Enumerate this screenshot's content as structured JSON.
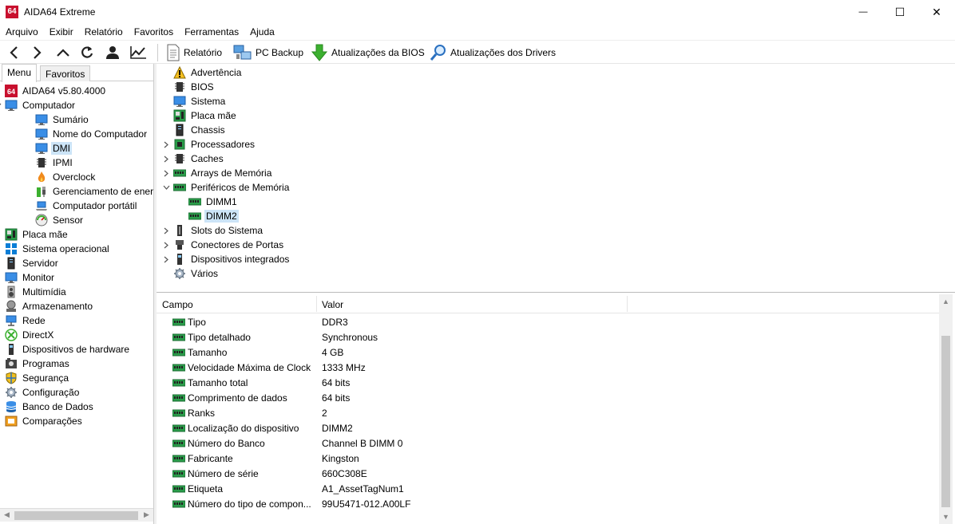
{
  "window": {
    "app_icon_text": "64",
    "title": "AIDA64 Extreme",
    "minimize": "—",
    "maximize": "☐",
    "close": "✕"
  },
  "menu": [
    "Arquivo",
    "Exibir",
    "Relatório",
    "Favoritos",
    "Ferramentas",
    "Ajuda"
  ],
  "toolbar": {
    "report": "Relatório",
    "pc_backup": "PC Backup",
    "bios_updates": "Atualizações da BIOS",
    "driver_updates": "Atualizações dos Drivers"
  },
  "tabs": {
    "menu": "Menu",
    "favorites": "Favoritos"
  },
  "left_tree": [
    {
      "label": "AIDA64 v5.80.4000",
      "icon": "aida64-icon",
      "level": 0,
      "chevron": ""
    },
    {
      "label": "Computador",
      "icon": "monitor-icon",
      "level": 0,
      "chevron": "open"
    },
    {
      "label": "Sumário",
      "icon": "monitor-icon",
      "level": 2,
      "chevron": ""
    },
    {
      "label": "Nome do Computador",
      "icon": "monitor-icon",
      "level": 2,
      "chevron": ""
    },
    {
      "label": "DMI",
      "icon": "monitor-icon",
      "level": 2,
      "chevron": "",
      "selected": true
    },
    {
      "label": "IPMI",
      "icon": "chip-icon",
      "level": 2,
      "chevron": ""
    },
    {
      "label": "Overclock",
      "icon": "flame-icon",
      "level": 2,
      "chevron": ""
    },
    {
      "label": "Gerenciamento de ener",
      "icon": "power-plug-icon",
      "level": 2,
      "chevron": ""
    },
    {
      "label": "Computador portátil",
      "icon": "laptop-icon",
      "level": 2,
      "chevron": ""
    },
    {
      "label": "Sensor",
      "icon": "gauge-icon",
      "level": 2,
      "chevron": ""
    },
    {
      "label": "Placa mãe",
      "icon": "motherboard-icon",
      "level": 0,
      "chevron": "closed"
    },
    {
      "label": "Sistema operacional",
      "icon": "windows-icon",
      "level": 0,
      "chevron": "closed"
    },
    {
      "label": "Servidor",
      "icon": "server-icon",
      "level": 0,
      "chevron": "closed"
    },
    {
      "label": "Monitor",
      "icon": "monitor-icon",
      "level": 0,
      "chevron": "closed"
    },
    {
      "label": "Multimídia",
      "icon": "speaker-icon",
      "level": 0,
      "chevron": "closed"
    },
    {
      "label": "Armazenamento",
      "icon": "storage-icon",
      "level": 0,
      "chevron": "closed"
    },
    {
      "label": "Rede",
      "icon": "network-icon",
      "level": 0,
      "chevron": "closed"
    },
    {
      "label": "DirectX",
      "icon": "xbox-icon",
      "level": 0,
      "chevron": "closed"
    },
    {
      "label": "Dispositivos de hardware",
      "icon": "device-icon",
      "level": 0,
      "chevron": "closed"
    },
    {
      "label": "Programas",
      "icon": "programs-icon",
      "level": 0,
      "chevron": "closed"
    },
    {
      "label": "Segurança",
      "icon": "shield-icon",
      "level": 0,
      "chevron": "closed"
    },
    {
      "label": "Configuração",
      "icon": "gear-icon",
      "level": 0,
      "chevron": "closed"
    },
    {
      "label": "Banco de Dados",
      "icon": "database-icon",
      "level": 0,
      "chevron": "closed"
    },
    {
      "label": "Comparações",
      "icon": "benchmark-icon",
      "level": 0,
      "chevron": "closed"
    }
  ],
  "dmi_tree": [
    {
      "label": "Advertência",
      "icon": "warning-icon",
      "level": 0,
      "chevron": ""
    },
    {
      "label": "BIOS",
      "icon": "chip-icon",
      "level": 0,
      "chevron": ""
    },
    {
      "label": "Sistema",
      "icon": "monitor-icon",
      "level": 0,
      "chevron": ""
    },
    {
      "label": "Placa mãe",
      "icon": "motherboard-icon",
      "level": 0,
      "chevron": ""
    },
    {
      "label": "Chassis",
      "icon": "server-icon",
      "level": 0,
      "chevron": ""
    },
    {
      "label": "Processadores",
      "icon": "cpu-icon",
      "level": 0,
      "chevron": "closed"
    },
    {
      "label": "Caches",
      "icon": "chip-icon",
      "level": 0,
      "chevron": "closed"
    },
    {
      "label": "Arrays de Memória",
      "icon": "ram-icon",
      "level": 0,
      "chevron": "closed"
    },
    {
      "label": "Periféricos de Memória",
      "icon": "ram-icon",
      "level": 0,
      "chevron": "open"
    },
    {
      "label": "DIMM1",
      "icon": "ram-icon",
      "level": 1,
      "chevron": ""
    },
    {
      "label": "DIMM2",
      "icon": "ram-icon",
      "level": 1,
      "chevron": "",
      "selected": true
    },
    {
      "label": "Slots do Sistema",
      "icon": "slot-icon",
      "level": 0,
      "chevron": "closed"
    },
    {
      "label": "Conectores de Portas",
      "icon": "port-icon",
      "level": 0,
      "chevron": "closed"
    },
    {
      "label": "Dispositivos integrados",
      "icon": "device-icon",
      "level": 0,
      "chevron": "closed"
    },
    {
      "label": "Vários",
      "icon": "gear-icon",
      "level": 0,
      "chevron": ""
    }
  ],
  "details": {
    "col_field": "Campo",
    "col_value": "Valor",
    "rows": [
      {
        "field": "Tipo",
        "value": "DDR3"
      },
      {
        "field": "Tipo detalhado",
        "value": "Synchronous"
      },
      {
        "field": "Tamanho",
        "value": "4 GB"
      },
      {
        "field": "Velocidade Máxima de Clock",
        "value": "1333 MHz"
      },
      {
        "field": "Tamanho total",
        "value": "64 bits"
      },
      {
        "field": "Comprimento de dados",
        "value": "64 bits"
      },
      {
        "field": "Ranks",
        "value": "2"
      },
      {
        "field": "Localização do dispositivo",
        "value": "DIMM2"
      },
      {
        "field": "Número do Banco",
        "value": "Channel B DIMM 0"
      },
      {
        "field": "Fabricante",
        "value": "Kingston"
      },
      {
        "field": "Número de série",
        "value": "660C308E"
      },
      {
        "field": "Etiqueta",
        "value": "A1_AssetTagNum1"
      },
      {
        "field": "Número do tipo de compon...",
        "value": "99U5471-012.A00LF"
      }
    ]
  }
}
